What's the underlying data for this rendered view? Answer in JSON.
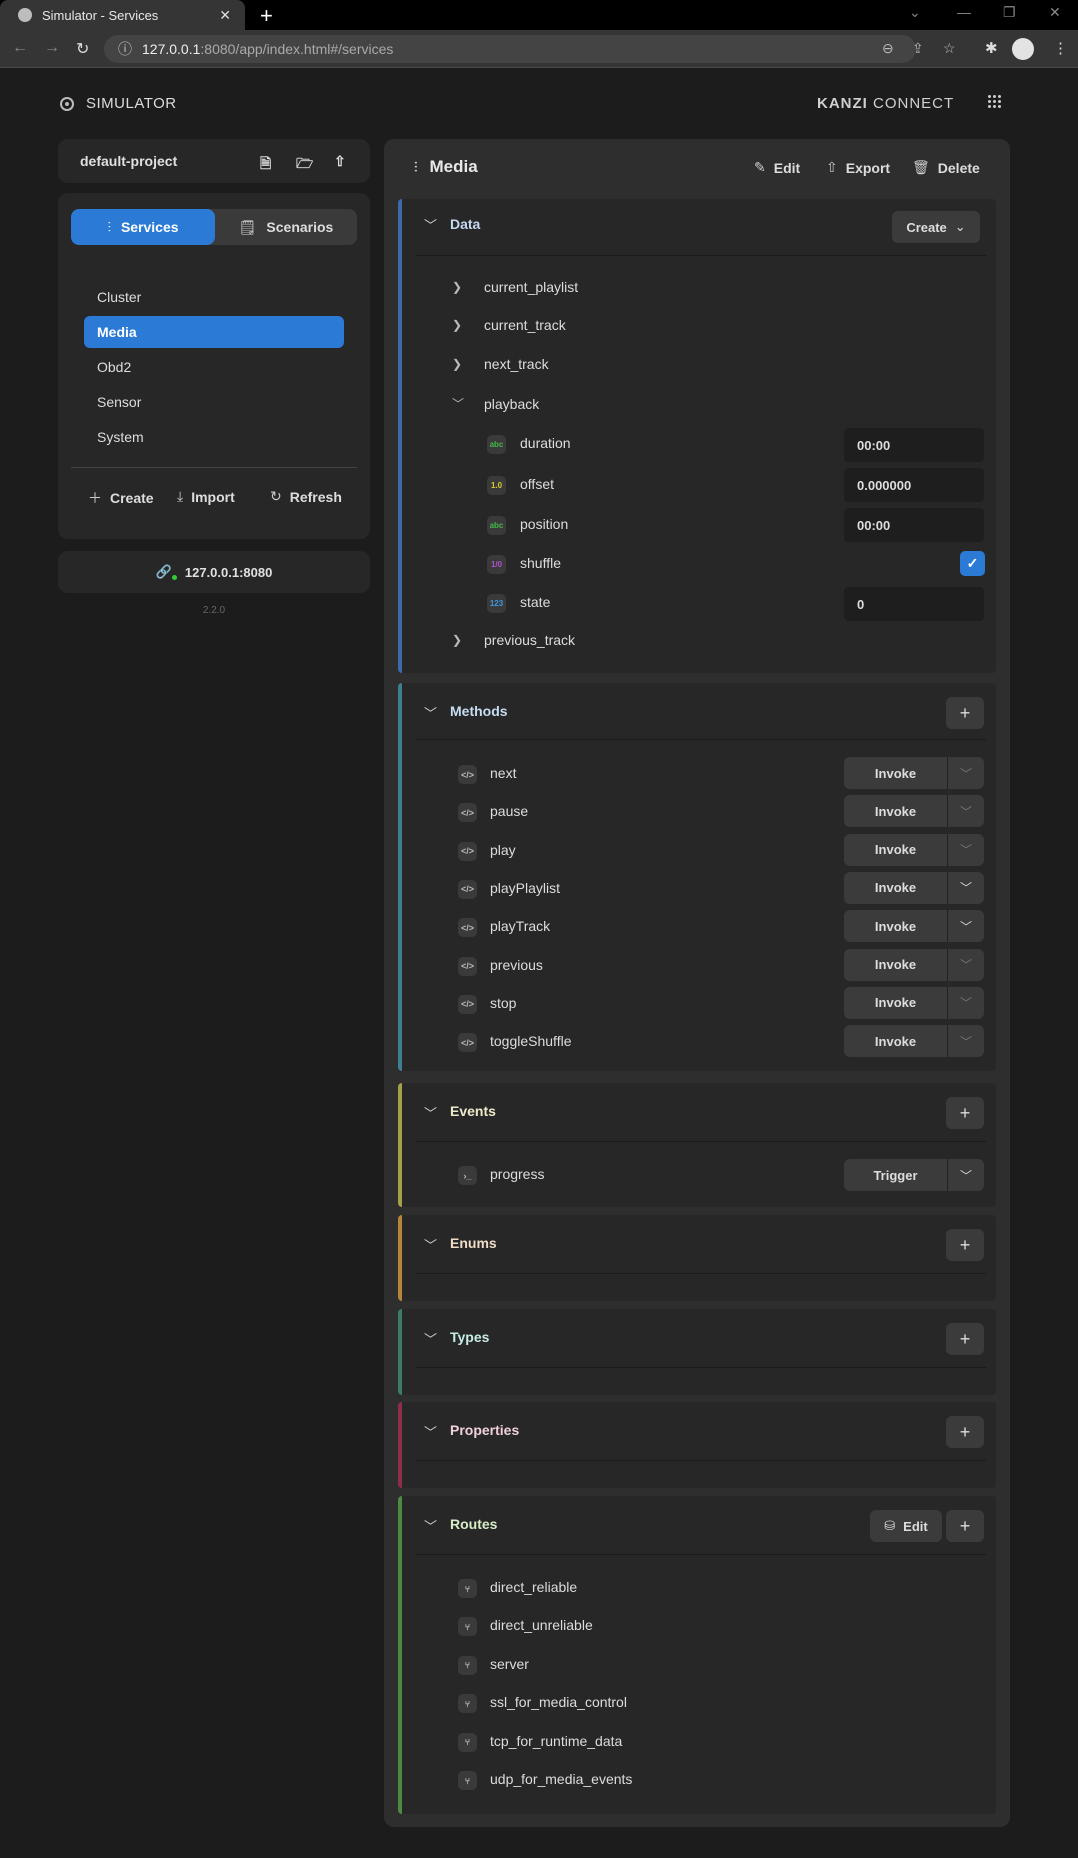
{
  "browser": {
    "tab_title": "Simulator - Services",
    "url_host": "127.0.0.1",
    "url_rest": ":8080/app/index.html#/services"
  },
  "app": {
    "brand": "SIMULATOR",
    "logo_bold": "KANZI",
    "logo_light": "CONNECT"
  },
  "sidebar": {
    "project_name": "default-project",
    "tabs": [
      {
        "label": "Services",
        "active": true
      },
      {
        "label": "Scenarios",
        "active": false
      }
    ],
    "services": [
      {
        "label": "Cluster",
        "active": false
      },
      {
        "label": "Media",
        "active": true
      },
      {
        "label": "Obd2",
        "active": false
      },
      {
        "label": "Sensor",
        "active": false
      },
      {
        "label": "System",
        "active": false
      }
    ],
    "actions": {
      "create": "Create",
      "import": "Import",
      "refresh": "Refresh"
    },
    "connection": "127.0.0.1:8080",
    "version": "2.2.0"
  },
  "main": {
    "title": "Media",
    "actions": {
      "edit": "Edit",
      "export": "Export",
      "delete": "Delete"
    },
    "data": {
      "title": "Data",
      "create_label": "Create",
      "items": [
        {
          "name": "current_playlist",
          "expanded": false
        },
        {
          "name": "current_track",
          "expanded": false
        },
        {
          "name": "next_track",
          "expanded": false
        },
        {
          "name": "playback",
          "expanded": true
        },
        {
          "name": "previous_track",
          "expanded": false
        }
      ],
      "playback_fields": [
        {
          "name": "duration",
          "type_badge": "abc",
          "value": "00:00"
        },
        {
          "name": "offset",
          "type_badge": "1.0",
          "value": "0.000000"
        },
        {
          "name": "position",
          "type_badge": "abc",
          "value": "00:00"
        },
        {
          "name": "shuffle",
          "type_badge": "1/0",
          "checked": true,
          "check_glyph": "✓"
        },
        {
          "name": "state",
          "type_badge": "123",
          "value": "0"
        }
      ]
    },
    "methods": {
      "title": "Methods",
      "invoke_label": "Invoke",
      "items": [
        {
          "name": "next",
          "has_args": false
        },
        {
          "name": "pause",
          "has_args": false
        },
        {
          "name": "play",
          "has_args": false
        },
        {
          "name": "playPlaylist",
          "has_args": true
        },
        {
          "name": "playTrack",
          "has_args": true
        },
        {
          "name": "previous",
          "has_args": false
        },
        {
          "name": "stop",
          "has_args": false
        },
        {
          "name": "toggleShuffle",
          "has_args": false
        }
      ]
    },
    "events": {
      "title": "Events",
      "trigger_label": "Trigger",
      "items": [
        {
          "name": "progress"
        }
      ]
    },
    "enums": {
      "title": "Enums"
    },
    "types": {
      "title": "Types"
    },
    "properties": {
      "title": "Properties"
    },
    "routes": {
      "title": "Routes",
      "edit_label": "Edit",
      "items": [
        {
          "name": "direct_reliable"
        },
        {
          "name": "direct_unreliable"
        },
        {
          "name": "server"
        },
        {
          "name": "ssl_for_media_control"
        },
        {
          "name": "tcp_for_runtime_data"
        },
        {
          "name": "udp_for_media_events"
        }
      ]
    },
    "section_colors": {
      "data": "#3b6aa8",
      "methods": "#3f7f93",
      "events": "#a3a24a",
      "enums": "#b7843c",
      "types": "#3c7a6c",
      "properties": "#8f2f47",
      "routes": "#4f8a45"
    }
  },
  "accent": "#2b7bd6",
  "type_colors": {
    "abc": "#41b94a",
    "1.0": "#d6cc2a",
    "1/0": "#b052d0",
    "123": "#3c97e0"
  }
}
